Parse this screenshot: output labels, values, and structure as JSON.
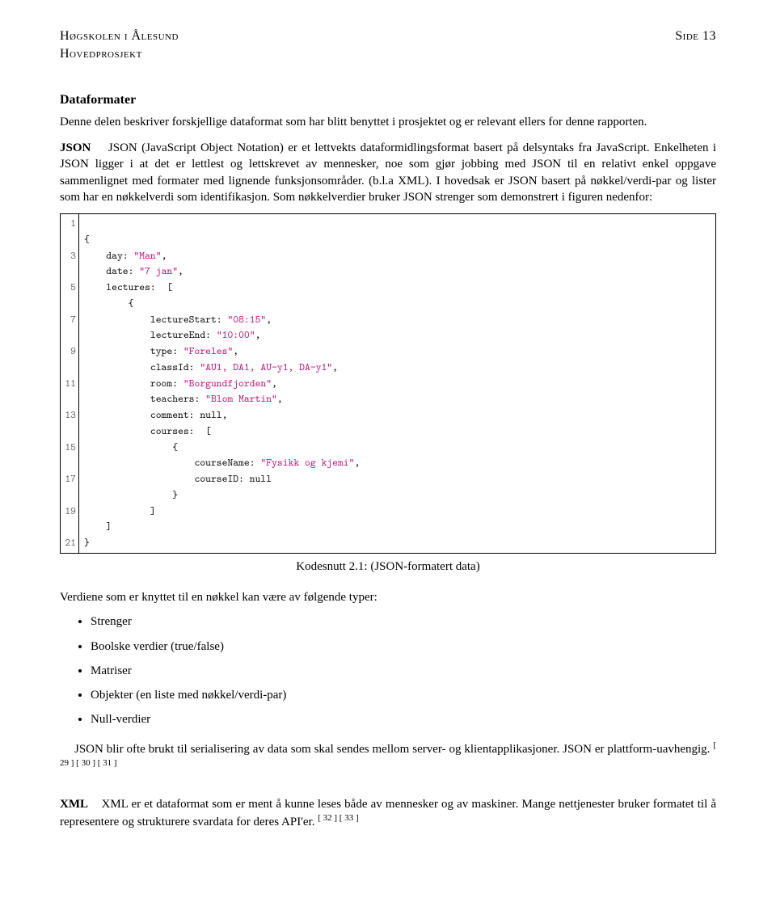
{
  "runhead": {
    "left1": "Høgskolen i Ålesund",
    "left2": "Hovedprosjekt",
    "right": "Side 13"
  },
  "section": {
    "title": "Dataformater",
    "intro": "Denne delen beskriver forskjellige dataformat som har blitt benyttet i prosjektet og er relevant ellers for denne rapporten."
  },
  "json_para": {
    "head": "JSON",
    "body": "JSON (JavaScript Object Notation) er et lettvekts dataformidlingsformat basert på delsyntaks fra JavaScript. Enkelheten i JSON ligger i at det er lettlest og lettskrevet av mennesker, noe som gjør jobbing med JSON til en relativt enkel oppgave sammenlignet med formater med lignende funksjonsområder. (b.l.a XML). I hovedsak er JSON basert på nøkkel/verdi-par og lister som har en nøkkelverdi som identifikasjon. Som nøkkelverdier bruker JSON strenger som demonstrert i figuren nedenfor:"
  },
  "code": {
    "gutter": [
      "1",
      "",
      "3",
      "",
      "5",
      "",
      "7",
      "",
      "9",
      "",
      "11",
      "",
      "13",
      "",
      "15",
      "",
      "17",
      "",
      "19",
      "",
      "21"
    ],
    "lines": [
      {
        "t": ""
      },
      {
        "t": "{"
      },
      {
        "t": "    day: ",
        "s": "\"Man\"",
        "t2": ","
      },
      {
        "t": "    date: ",
        "s": "\"7 jan\"",
        "t2": ","
      },
      {
        "t": "    lectures:  ["
      },
      {
        "t": "        {"
      },
      {
        "t": "            lectureStart: ",
        "s": "\"08:15\"",
        "t2": ","
      },
      {
        "t": "            lectureEnd: ",
        "s": "\"10:00\"",
        "t2": ","
      },
      {
        "t": "            type: ",
        "s": "\"Foreles\"",
        "t2": ","
      },
      {
        "t": "            classId: ",
        "s": "\"AU1, DA1, AU−y1, DA−y1\"",
        "t2": ","
      },
      {
        "t": "            room: ",
        "s": "\"Borgundfjorden\"",
        "t2": ","
      },
      {
        "t": "            teachers: ",
        "s": "\"Blom Martin\"",
        "t2": ","
      },
      {
        "t": "            comment: null,"
      },
      {
        "t": "            courses:  ["
      },
      {
        "t": "                {"
      },
      {
        "t": "                    courseName: ",
        "s": "\"Fysikk og kjemi\"",
        "t2": ","
      },
      {
        "t": "                    courseID: null"
      },
      {
        "t": "                }"
      },
      {
        "t": "            ]"
      },
      {
        "t": "    ]"
      },
      {
        "t": "}"
      }
    ]
  },
  "caption": "Kodesnutt 2.1: (JSON-formatert data)",
  "after_caption": "Verdiene som er knyttet til en nøkkel kan være av følgende typer:",
  "bullets": [
    "Strenger",
    "Boolske verdier (true/false)",
    "Matriser",
    "Objekter (en liste med nøkkel/verdi-par)",
    "Null-verdier"
  ],
  "json_tail": {
    "text": "JSON blir ofte brukt til serialisering av data som skal sendes mellom server- og klientapplikasjoner. JSON er plattform-uavhengig. ",
    "cites": "[ 29 ]  [ 30 ]  [ 31 ]"
  },
  "xml_para": {
    "head": "XML",
    "body": "XML er et dataformat som er ment å kunne leses både av mennesker og av maskiner. Mange nettjenester bruker formatet til å representere og strukturere svardata for deres API'er. ",
    "cites": "[ 32 ]  [ 33 ]"
  }
}
